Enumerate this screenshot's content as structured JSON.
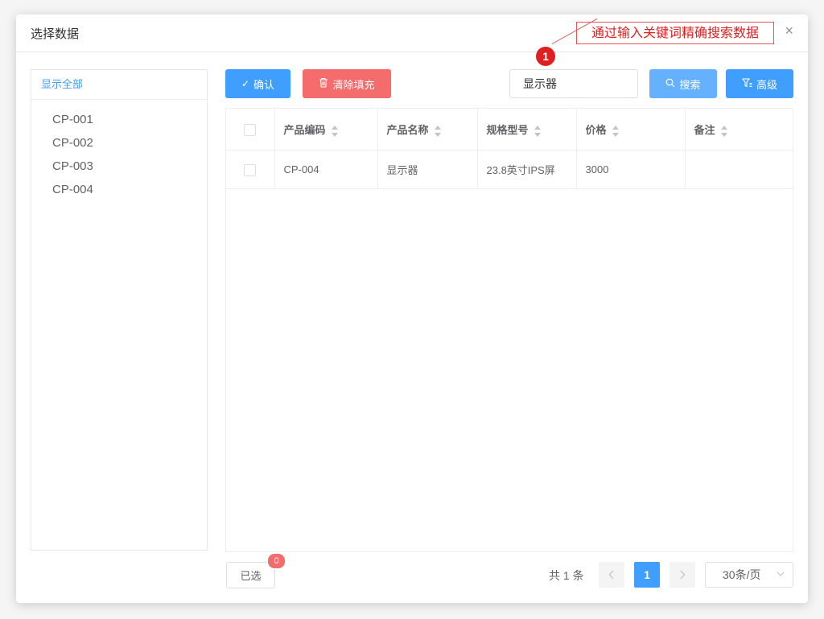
{
  "dialog": {
    "title": "选择数据",
    "close": "×"
  },
  "annotation": {
    "marker": "1",
    "text": "通过输入关键词精确搜索数据"
  },
  "sidebar": {
    "header": "显示全部",
    "items": [
      "CP-001",
      "CP-002",
      "CP-003",
      "CP-004"
    ]
  },
  "toolbar": {
    "confirm_label": "确认",
    "clear_label": "清除填充",
    "search_value": "显示器",
    "search_label": "搜索",
    "advanced_label": "高级"
  },
  "table": {
    "columns": [
      "产品编码",
      "产品名称",
      "规格型号",
      "价格",
      "备注"
    ],
    "rows": [
      {
        "code": "CP-004",
        "name": "显示器",
        "spec": "23.8英寸IPS屏",
        "price": "3000",
        "note": ""
      }
    ]
  },
  "footer": {
    "selected_label": "已选",
    "selected_count": "0",
    "total_text": "共 1 条",
    "current_page": "1",
    "page_size": "30条/页"
  },
  "colors": {
    "primary": "#409eff",
    "danger": "#f56c6c",
    "annotation": "#e02020"
  }
}
